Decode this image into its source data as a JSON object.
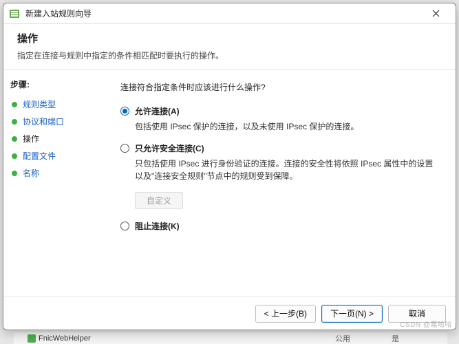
{
  "titlebar": {
    "title": "新建入站规则向导"
  },
  "header": {
    "title": "操作",
    "subtitle": "指定在连接与规则中指定的条件相匹配时要执行的操作。"
  },
  "sidebar": {
    "steps_label": "步骤:",
    "items": [
      {
        "label": "规则类型",
        "current": false
      },
      {
        "label": "协议和端口",
        "current": false
      },
      {
        "label": "操作",
        "current": true
      },
      {
        "label": "配置文件",
        "current": false
      },
      {
        "label": "名称",
        "current": false
      }
    ]
  },
  "main": {
    "question": "连接符合指定条件时应该进行什么操作?",
    "options": [
      {
        "id": "allow",
        "label": "允许连接(A)",
        "desc": "包括使用 IPsec 保护的连接，以及未使用 IPsec 保护的连接。",
        "selected": true
      },
      {
        "id": "allow-secure",
        "label": "只允许安全连接(C)",
        "desc": "只包括使用 IPsec 进行身份验证的连接。连接的安全性将依照 IPsec 属性中的设置以及\"连接安全规则\"节点中的规则受到保障。",
        "selected": false
      },
      {
        "id": "block",
        "label": "阻止连接(K)",
        "desc": "",
        "selected": false
      }
    ],
    "customize_label": "自定义"
  },
  "footer": {
    "back": "< 上一步(B)",
    "next": "下一页(N) >",
    "cancel": "取消"
  },
  "background": {
    "app_name": "FnicWebHelper",
    "col1": "公用",
    "col2": "是"
  },
  "watermark": "CSDN @嘉哈哈"
}
